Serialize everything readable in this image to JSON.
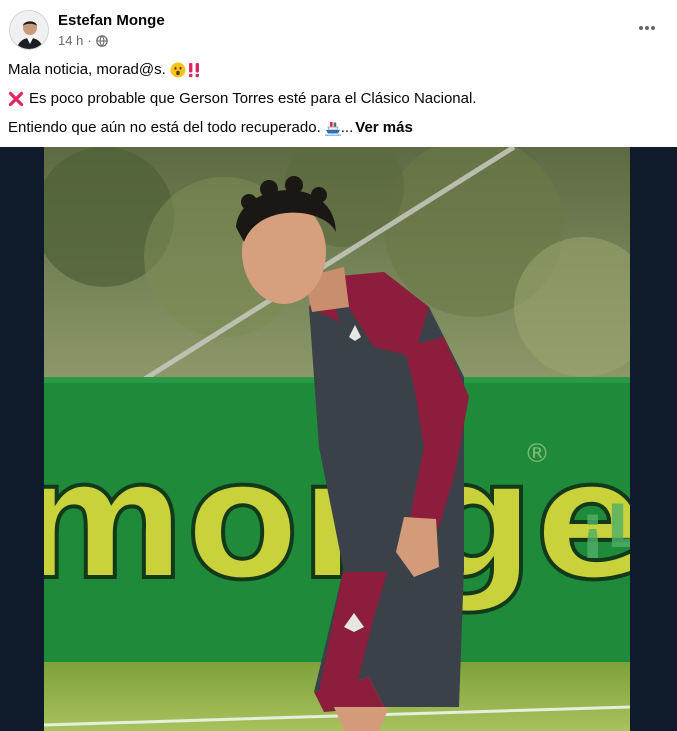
{
  "post": {
    "author": "Estefan Monge",
    "time": "14 h",
    "separator": "·",
    "lines": [
      "Mala noticia, morad@s.",
      "Es poco probable que Gerson Torres esté para el Clásico Nacional.",
      "Entiendo que aún no está del todo recuperado."
    ],
    "ellipsis": "...",
    "see_more": "Ver más"
  },
  "photo": {
    "banner_text": "monge",
    "banner_registered": "®",
    "banner_side_text": "¡L",
    "colors": {
      "banner_green": "#1f8a3a",
      "banner_letters": "#c9d23a",
      "jersey_maroon": "#8c1d3c",
      "jersey_grey": "#3b4148"
    }
  },
  "icons": {
    "globe": "globe-icon",
    "more": "more-options-icon",
    "surprised": "surprised-face-emoji",
    "double_exclamation": "double-exclamation-emoji",
    "cross": "cross-mark-emoji",
    "ship": "ship-emoji"
  }
}
